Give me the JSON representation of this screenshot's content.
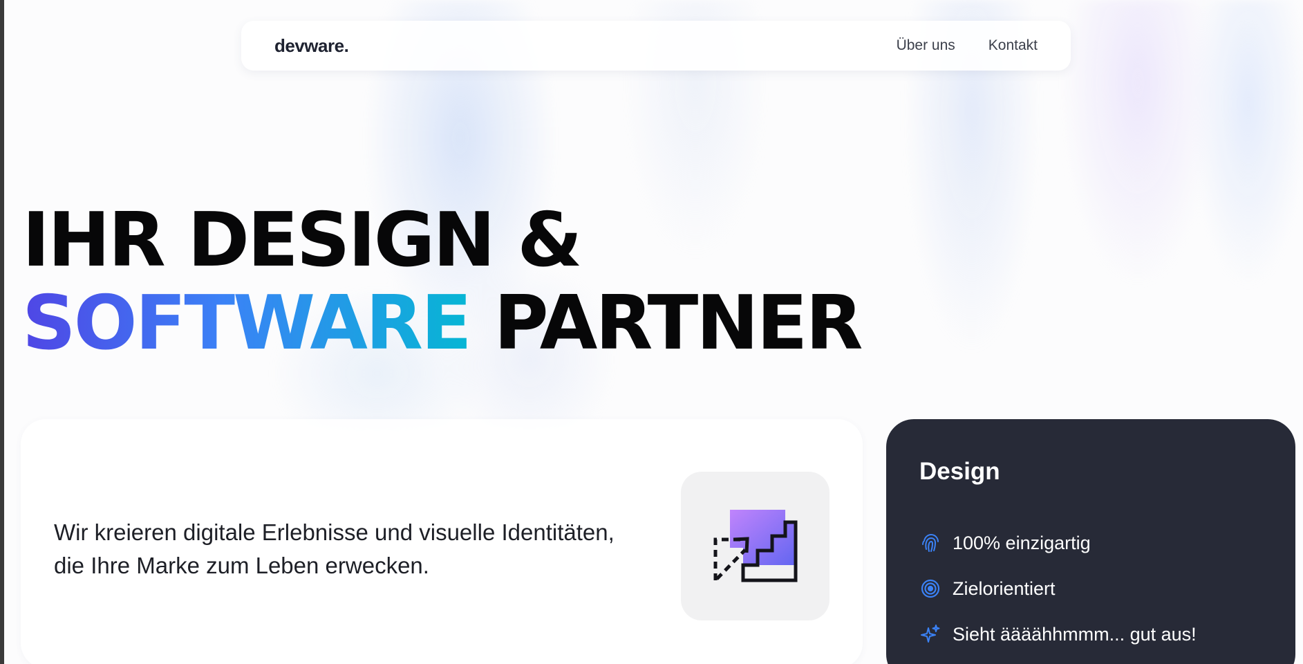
{
  "nav": {
    "logo": "devware.",
    "links": [
      "Über uns",
      "Kontakt"
    ]
  },
  "hero": {
    "line1": "IHR DESIGN &",
    "line2_gradient": "SOFTWARE",
    "line2_rest": "PARTNER"
  },
  "intro": {
    "text": "Wir kreieren digitale Erlebnisse und visuelle Identitäten, die Ihre Marke zum Leben erwecken.",
    "icon": "steps-growth-icon"
  },
  "design_card": {
    "title": "Design",
    "features": [
      {
        "icon": "fingerprint-icon",
        "label": "100% einzigartig"
      },
      {
        "icon": "target-icon",
        "label": "Zielorientiert"
      },
      {
        "icon": "sparkle-icon",
        "label": "Sieht äääähhmmm... gut aus!"
      }
    ]
  },
  "colors": {
    "accent_gradient": [
      "#4f46e5",
      "#3b82f6",
      "#06b6d4"
    ],
    "icon_gradient": [
      "#c084fc",
      "#6366f1"
    ],
    "card_dark": "#272a37",
    "feature_icon": "#3b82f6"
  }
}
